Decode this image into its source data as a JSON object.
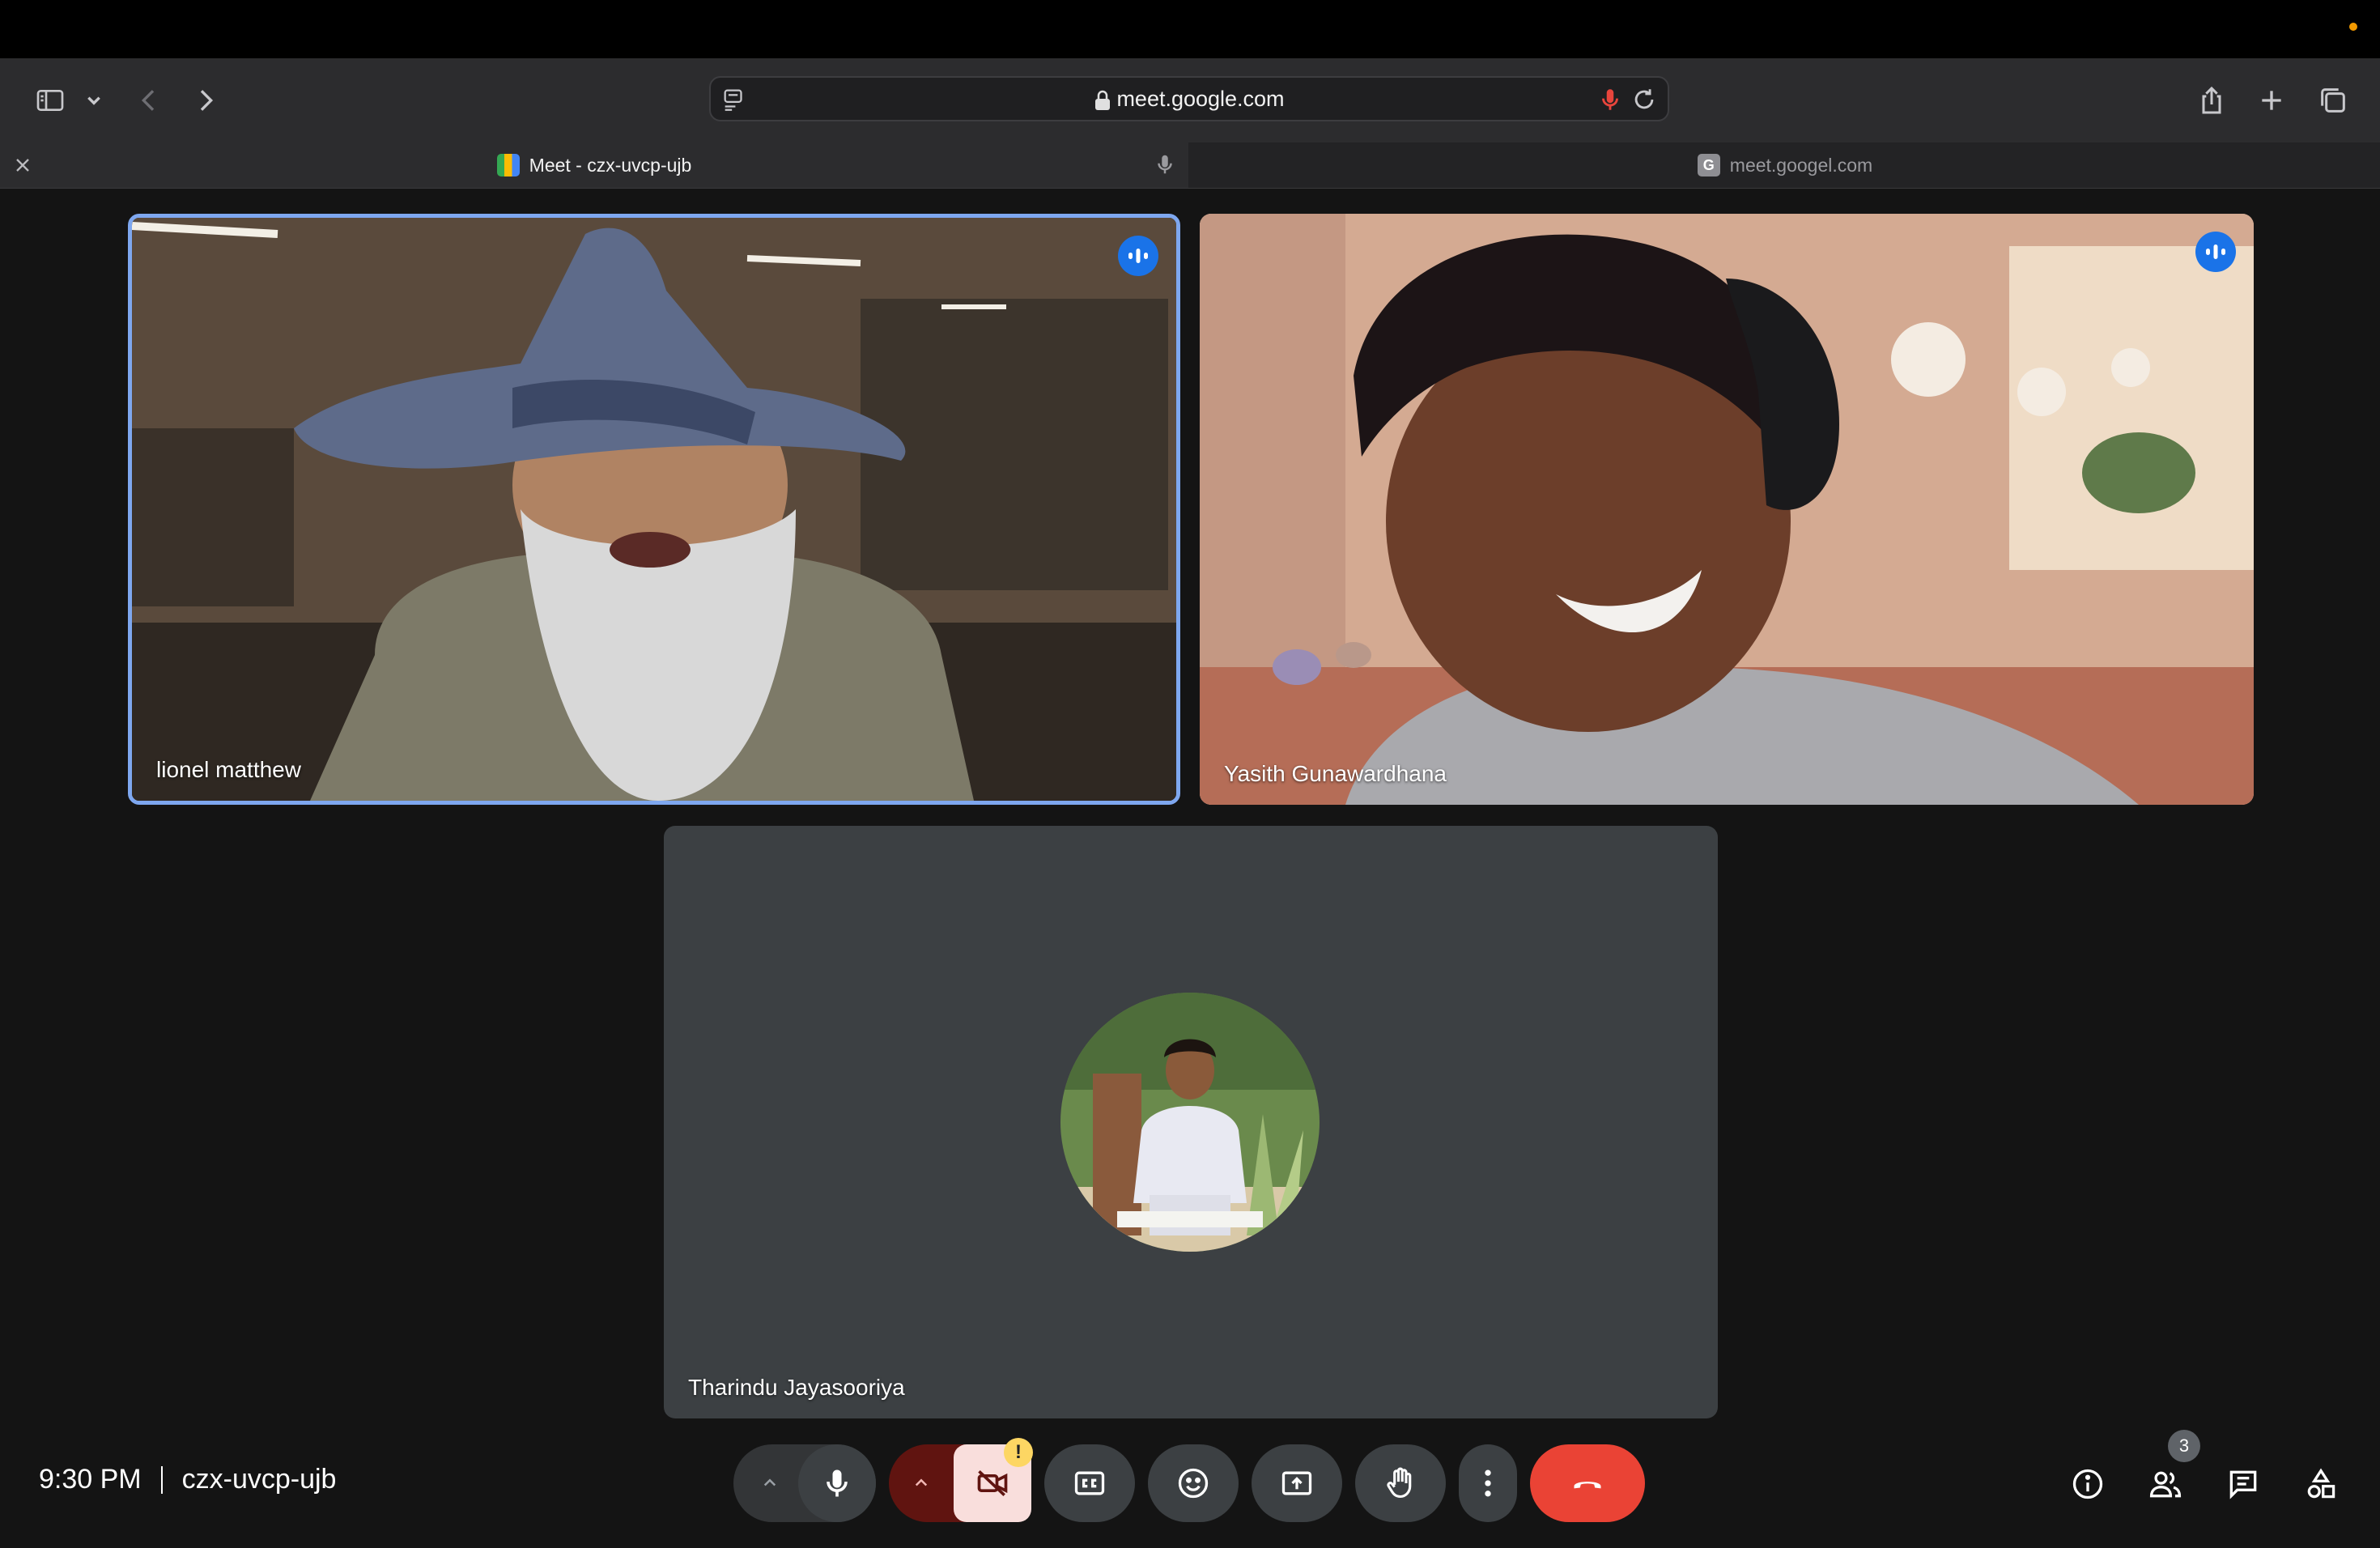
{
  "browser": {
    "url": "meet.google.com",
    "tabs": [
      {
        "label": "Meet - czx-uvcp-ujb",
        "favicon": "google-meet-icon",
        "active": true
      },
      {
        "label": "meet.googel.com",
        "favicon": "g-letter-icon",
        "active": false
      }
    ]
  },
  "participants": [
    {
      "name": "lionel matthew",
      "speaking": true,
      "video": true
    },
    {
      "name": "Yasith Gunawardhana",
      "speaking": true,
      "video": true
    },
    {
      "name": "Tharindu Jayasooriya",
      "speaking": false,
      "video": false
    }
  ],
  "footer": {
    "time": "9:30 PM",
    "meeting_code": "czx-uvcp-ujb",
    "people_count": "3"
  },
  "colors": {
    "accent": "#1a73e8",
    "end_call": "#ea4335",
    "camera_off_bg": "#f9dedc",
    "camera_group_bg": "#601410",
    "warning": "#fdd663"
  }
}
